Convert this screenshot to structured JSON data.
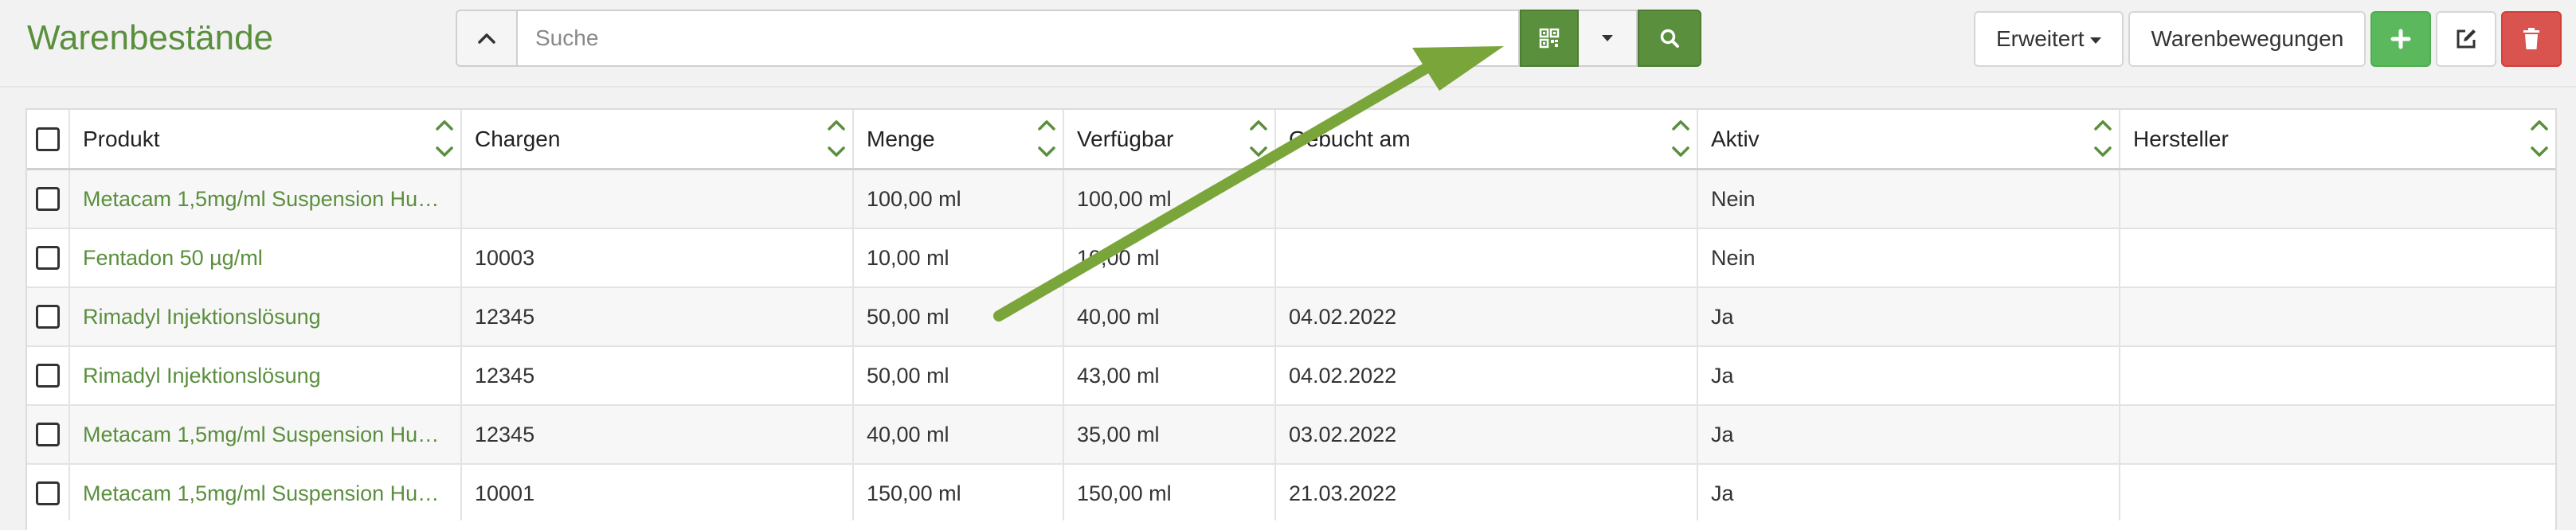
{
  "page": {
    "title": "Warenbestände"
  },
  "search": {
    "placeholder": "Suche",
    "value": ""
  },
  "toolbar": {
    "advanced_label": "Erweitert",
    "movements_label": "Warenbewegungen"
  },
  "table": {
    "columns": [
      "Produkt",
      "Chargen",
      "Menge",
      "Verfügbar",
      "Gebucht am",
      "Aktiv",
      "Hersteller"
    ],
    "rows": [
      {
        "produkt": "Metacam 1,5mg/ml Suspension Hu…",
        "charge": "",
        "menge": "100,00 ml",
        "verfuegbar": "100,00 ml",
        "gebucht": "",
        "aktiv": "Nein",
        "hersteller": ""
      },
      {
        "produkt": "Fentadon 50 µg/ml",
        "charge": "10003",
        "menge": "10,00 ml",
        "verfuegbar": "10,00 ml",
        "gebucht": "",
        "aktiv": "Nein",
        "hersteller": ""
      },
      {
        "produkt": "Rimadyl Injektionslösung",
        "charge": "12345",
        "menge": "50,00 ml",
        "verfuegbar": "40,00 ml",
        "gebucht": "04.02.2022",
        "aktiv": "Ja",
        "hersteller": ""
      },
      {
        "produkt": "Rimadyl Injektionslösung",
        "charge": "12345",
        "menge": "50,00 ml",
        "verfuegbar": "43,00 ml",
        "gebucht": "04.02.2022",
        "aktiv": "Ja",
        "hersteller": ""
      },
      {
        "produkt": "Metacam 1,5mg/ml Suspension Hu…",
        "charge": "12345",
        "menge": "40,00 ml",
        "verfuegbar": "35,00 ml",
        "gebucht": "03.02.2022",
        "aktiv": "Ja",
        "hersteller": ""
      },
      {
        "produkt": "Metacam 1,5mg/ml Suspension Hu…",
        "charge": "10001",
        "menge": "150,00 ml",
        "verfuegbar": "150,00 ml",
        "gebucht": "21.03.2022",
        "aktiv": "Ja",
        "hersteller": ""
      }
    ]
  },
  "icons": {
    "collapse": "chevron-up-icon",
    "scan": "qr-code-icon",
    "dropdown": "caret-down-icon",
    "search": "search-icon",
    "add": "plus-icon",
    "edit": "edit-icon",
    "delete": "trash-icon",
    "sort": "sort-icon",
    "annotation": "arrow-annotation"
  },
  "colors": {
    "brand": "#5a8f3d",
    "add": "#5cb85c",
    "delete": "#d9534f",
    "annotation_arrow": "#7aa53a"
  }
}
